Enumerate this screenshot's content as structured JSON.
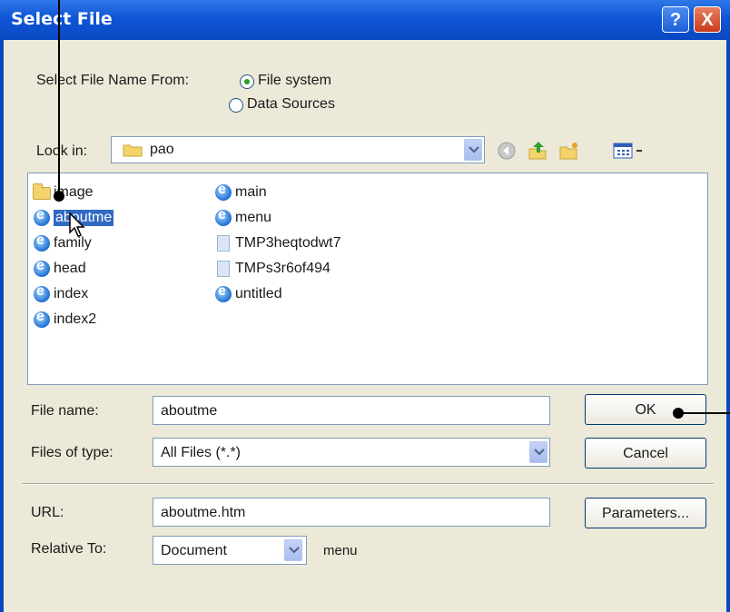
{
  "window": {
    "title": "Select File",
    "help_label": "?",
    "close_label": "X"
  },
  "source": {
    "label": "Select File Name From:",
    "options": [
      {
        "label": "File system",
        "selected": true
      },
      {
        "label": "Data Sources",
        "selected": false
      }
    ]
  },
  "lookin": {
    "label": "Look in:",
    "value": "pao"
  },
  "toolbar": {
    "icons": [
      "back-icon",
      "up-folder-icon",
      "new-folder-icon",
      "views-menu-icon"
    ]
  },
  "files": [
    {
      "name": "image",
      "icon": "folder-icon"
    },
    {
      "name": "aboutme",
      "icon": "ie-document-icon",
      "selected": true
    },
    {
      "name": "family",
      "icon": "ie-document-icon"
    },
    {
      "name": "head",
      "icon": "ie-document-icon"
    },
    {
      "name": "index",
      "icon": "ie-document-icon"
    },
    {
      "name": "index2",
      "icon": "ie-document-icon"
    },
    {
      "name": "main",
      "icon": "ie-document-icon"
    },
    {
      "name": "menu",
      "icon": "ie-document-icon"
    },
    {
      "name": "TMP3heqtodwt7",
      "icon": "document-icon"
    },
    {
      "name": "TMPs3r6of494",
      "icon": "document-icon"
    },
    {
      "name": "untitled",
      "icon": "ie-document-icon"
    }
  ],
  "filename": {
    "label": "File name:",
    "value": "aboutme"
  },
  "filetype": {
    "label": "Files of type:",
    "value": "All Files (*.*)"
  },
  "buttons": {
    "ok": "OK",
    "cancel": "Cancel",
    "parameters": "Parameters..."
  },
  "url": {
    "label": "URL:",
    "value": "aboutme.htm"
  },
  "relative": {
    "label": "Relative To:",
    "value": "Document",
    "context": "menu"
  },
  "colors": {
    "title_bar": "#0a48c2",
    "dialog_bg": "#ece9d8",
    "selection": "#316ac5",
    "radio_dot": "#21a121"
  }
}
